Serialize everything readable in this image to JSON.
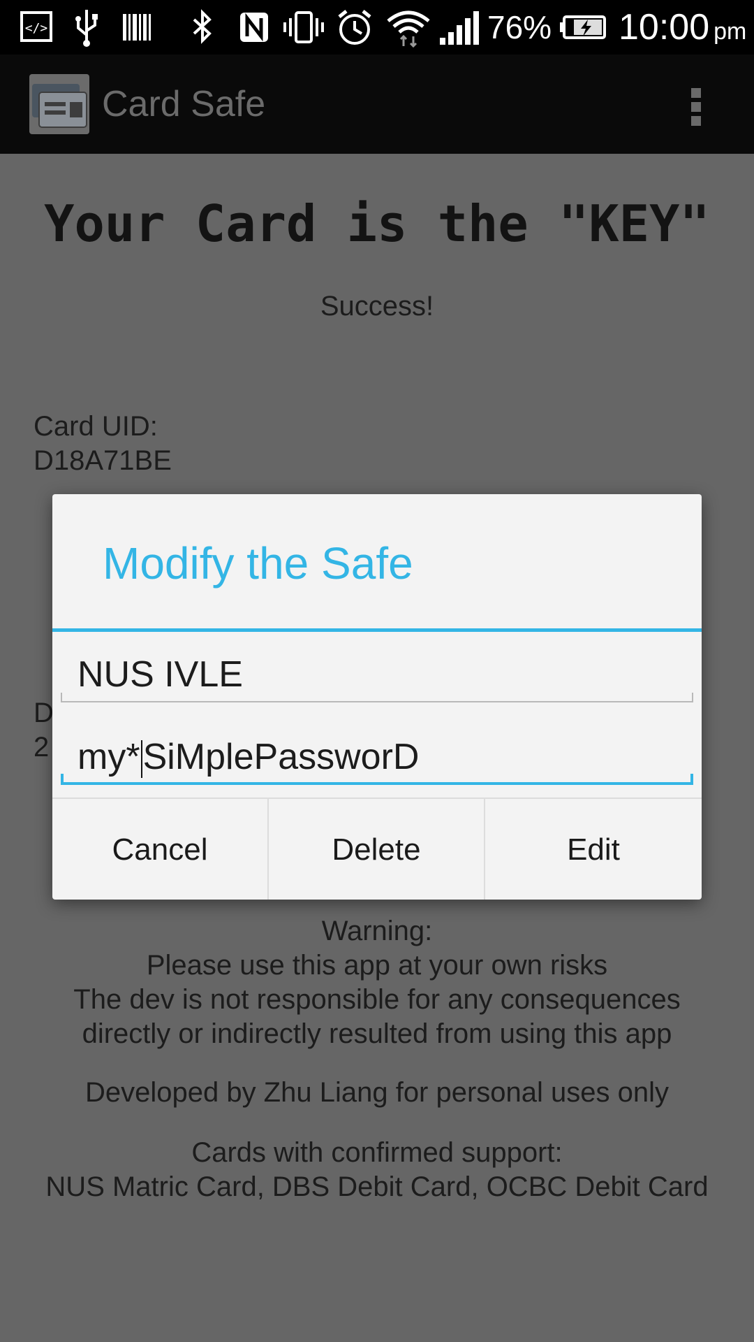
{
  "status_bar": {
    "battery_percent": "76%",
    "time": "10:00",
    "ampm": "pm",
    "icons": [
      "developer-icon",
      "usb-icon",
      "barcode-icon",
      "bluetooth-icon",
      "nfc-icon",
      "vibrate-icon",
      "alarm-icon",
      "wifi-icon",
      "signal-icon",
      "battery-charging-icon"
    ]
  },
  "action_bar": {
    "app_title": "Card Safe",
    "logo_icon": "card-stack-icon",
    "menu_icon": "overflow-menu-icon"
  },
  "main": {
    "headline": "Your Card is the \"KEY\"",
    "status_message": "Success!",
    "card_uid_label": "Card UID:",
    "card_uid_value": "D18A71BE",
    "partial_line_1": "D",
    "partial_line_2": "2",
    "warning_title": "Warning:",
    "warning_line_1": "Please use this app at your own risks",
    "warning_line_2": "The dev is not responsible for any consequences",
    "warning_line_3": "directly or indirectly resulted from using this app",
    "developer_note": "Developed by Zhu Liang for personal uses only",
    "cards_title": "Cards with confirmed support:",
    "cards_list": "NUS Matric Card, DBS Debit Card, OCBC Debit Card"
  },
  "dialog": {
    "title": "Modify the Safe",
    "name_value": "NUS IVLE",
    "password_before_cursor": "my*",
    "password_after_cursor": "SiMplePassworD",
    "buttons": {
      "cancel": "Cancel",
      "delete": "Delete",
      "edit": "Edit"
    }
  },
  "colors": {
    "accent": "#33b5e5",
    "background": "#666666",
    "dialog_background": "#f3f3f3",
    "action_bar": "#0a0a0a"
  }
}
